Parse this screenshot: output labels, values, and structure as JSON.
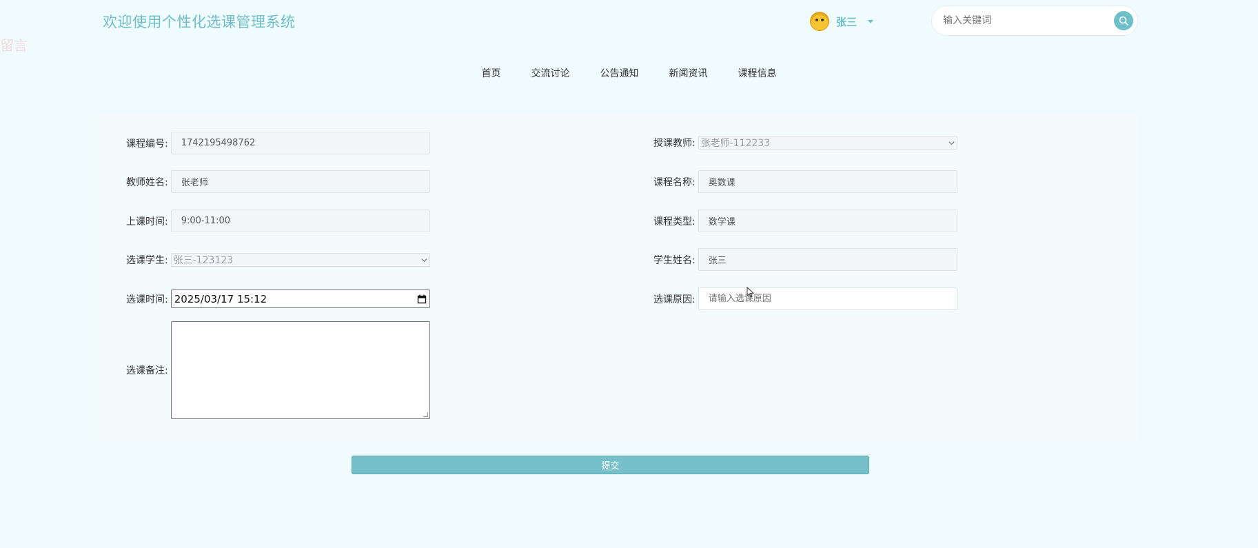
{
  "header": {
    "site_title": "欢迎使用个性化选课管理系统",
    "side_mark": "留言",
    "username": "张三",
    "search_placeholder": "输入关键词"
  },
  "nav": [
    {
      "label": "首页"
    },
    {
      "label": "交流讨论"
    },
    {
      "label": "公告通知"
    },
    {
      "label": "新闻资讯"
    },
    {
      "label": "课程信息"
    }
  ],
  "form": {
    "course_no": {
      "label": "课程编号:",
      "value": "1742195498762"
    },
    "teacher_account": {
      "label": "授课教师:",
      "value": "张老师-112233"
    },
    "teacher_name": {
      "label": "教师姓名:",
      "value": "张老师"
    },
    "course_name": {
      "label": "课程名称:",
      "value": "奥数课"
    },
    "class_time": {
      "label": "上课时间:",
      "value": "9:00-11:00"
    },
    "course_type": {
      "label": "课程类型:",
      "value": "数学课"
    },
    "student": {
      "label": "选课学生:",
      "value": "张三-123123"
    },
    "student_name": {
      "label": "学生姓名:",
      "value": "张三"
    },
    "select_time": {
      "label": "选课时间:",
      "value": "2025/03/17 15:12"
    },
    "reason": {
      "label": "选课原因:",
      "placeholder": "请输入选课原因"
    },
    "remark": {
      "label": "选课备注:",
      "value": ""
    }
  },
  "submit_label": "提交",
  "colors": {
    "accent": "#6fbfc9",
    "background": "#f0fbfd",
    "submit": "#75c0c9"
  }
}
